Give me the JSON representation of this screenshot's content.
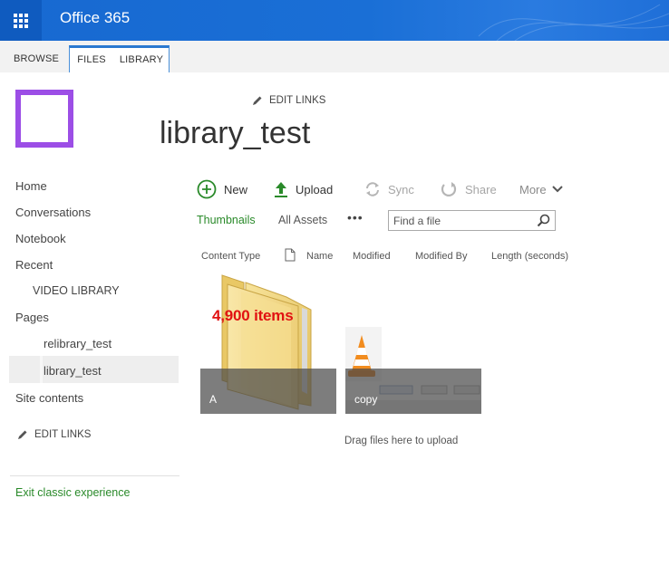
{
  "suite": {
    "title": "Office 365",
    "app_launcher_icon": "waffle-icon",
    "brand_color": "#1a6fd6"
  },
  "ribbon": {
    "tabs": [
      "BROWSE",
      "FILES",
      "LIBRARY"
    ]
  },
  "site": {
    "title": "library_test",
    "edit_links_label": "EDIT LINKS",
    "logo_color": "#9c4ee6"
  },
  "leftnav": {
    "items": [
      "Home",
      "Conversations",
      "Notebook",
      "Recent",
      "VIDEO LIBRARY",
      "Pages",
      "relibrary_test",
      "library_test",
      "Site contents"
    ],
    "edit_links_label": "EDIT LINKS",
    "exit_label": "Exit classic experience"
  },
  "commands": {
    "new": "New",
    "upload": "Upload",
    "sync": "Sync",
    "share": "Share",
    "more": "More"
  },
  "views": {
    "thumbnails": "Thumbnails",
    "all_assets": "All Assets",
    "more": "•••"
  },
  "search": {
    "placeholder": "Find a file"
  },
  "columns": [
    "Content Type",
    "Name",
    "Modified",
    "Modified By",
    "Length (seconds)"
  ],
  "tiles": [
    {
      "label": "A",
      "overlay_text": "4,900 items",
      "icon": "folder-icon"
    },
    {
      "label": "copy",
      "icon": "vlc-icon"
    }
  ],
  "upload_hint": "Drag files here to upload",
  "colors": {
    "accent_green": "#2a8a2a",
    "count_red": "#e11212"
  }
}
